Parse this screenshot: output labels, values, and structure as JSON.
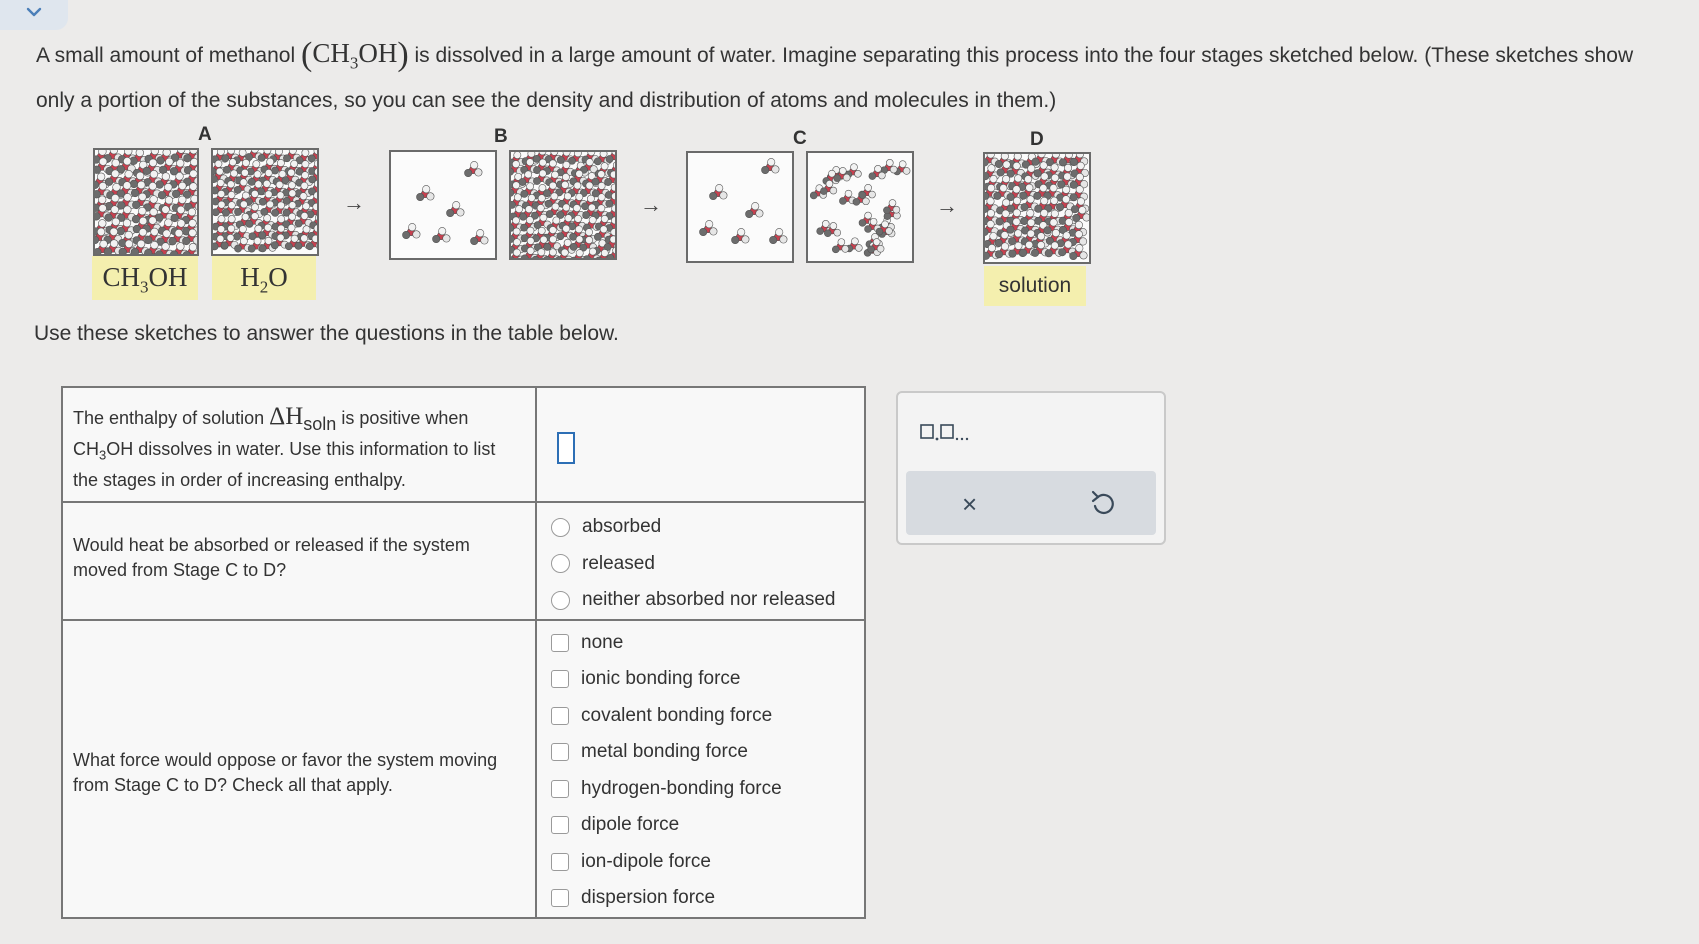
{
  "intro": {
    "part1": "A small amount of methanol ",
    "formula_main": "CH",
    "formula_sub": "3",
    "formula_end": "OH",
    "part2": " is dissolved in a large amount of water. Imagine separating this process into the four stages sketched below. (These sketches show only a portion of the substances, so you can see the density and distribution of atoms and molecules in them.)"
  },
  "stages": {
    "a": "A",
    "b": "B",
    "c": "C",
    "d": "D"
  },
  "labels": {
    "methanol_main": "CH",
    "methanol_sub": "3",
    "methanol_end": "OH",
    "water_main": "H",
    "water_sub": "2",
    "water_end": "O",
    "solution": "solution"
  },
  "arrows": [
    "→",
    "→",
    "→"
  ],
  "use_text": "Use these sketches to answer the questions in the table below.",
  "questions": {
    "q1": {
      "part1": "The enthalpy of solution ",
      "symbol": "ΔH",
      "symbol_sub": "soln",
      "part2": " is positive when",
      "part3_pre": "CH",
      "part3_sub": "3",
      "part3_post": "OH dissolves in water. Use this information to list the stages in order of increasing enthalpy."
    },
    "q2": {
      "text": "Would heat be absorbed or released if the system moved from Stage C to D?",
      "options": [
        "absorbed",
        "released",
        "neither absorbed nor released"
      ]
    },
    "q3": {
      "text": "What force would oppose or favor the system moving from Stage C to D? Check all that apply.",
      "options": [
        "none",
        "ionic bonding force",
        "covalent bonding force",
        "metal bonding force",
        "hydrogen-bonding force",
        "dipole force",
        "ion-dipole force",
        "dispersion force"
      ]
    }
  },
  "tools": {
    "list_icon": "list-format-icon",
    "clear": "×",
    "undo_icon": "undo-icon"
  },
  "colors": {
    "label_bg": "#f4efae",
    "answer_box_border": "#2d6fb5",
    "molecule_red": "#c8404f",
    "molecule_gray": "#6c6c6c"
  }
}
